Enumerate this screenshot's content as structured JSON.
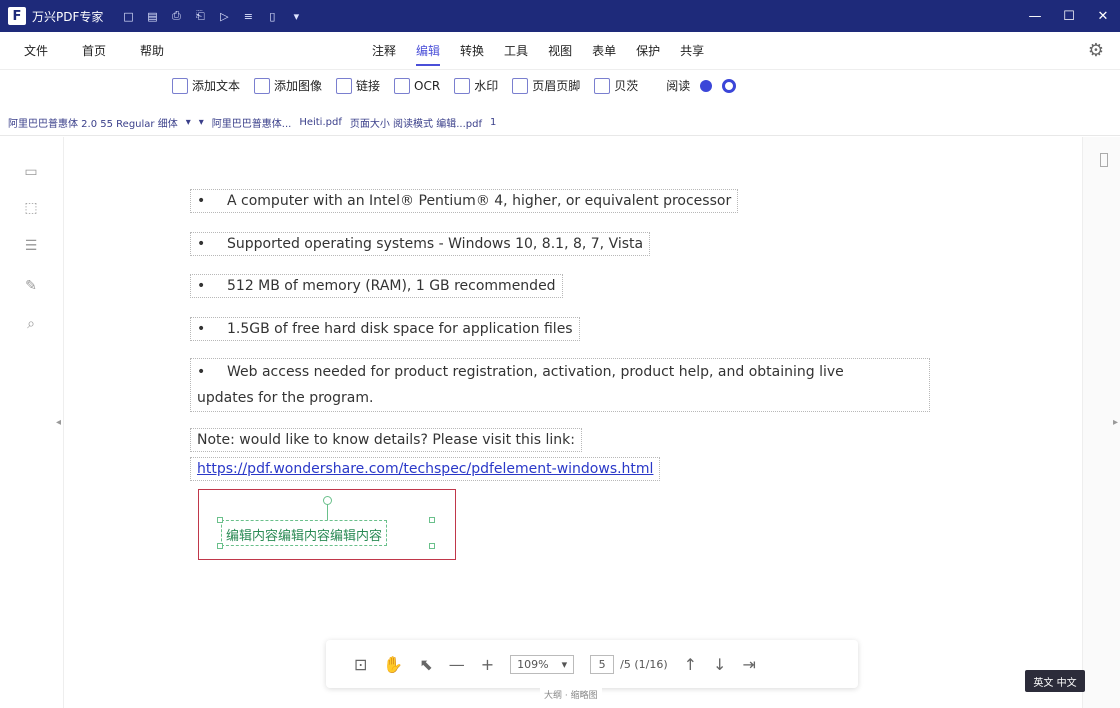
{
  "titlebar": {
    "app_name": "万兴PDF专家",
    "quick_icons": [
      "□",
      "▤",
      "⎙",
      "⎗",
      "▷",
      "≡",
      "▯",
      "▾"
    ],
    "window_controls": [
      "—",
      "☐",
      "✕"
    ]
  },
  "menubar": {
    "left_items": [
      "文件",
      "首页",
      "帮助"
    ],
    "tabs": [
      "注释",
      "编辑",
      "转换",
      "工具",
      "视图",
      "表单",
      "保护",
      "共享"
    ],
    "active_tab": "编辑",
    "right_icon": "⚙"
  },
  "ribbon": {
    "items": [
      "添加文本",
      "添加图像",
      "链接",
      "OCR",
      "水印",
      "页眉页脚",
      "贝茨"
    ],
    "extra": [
      "阅读"
    ]
  },
  "formatbar": {
    "segments": [
      "阿里巴巴普惠体 2.0 55 Regular 细体",
      "▾",
      "▾",
      "阿里巴巴普惠体...",
      "Heiti.pdf",
      "页面大小 阅读模式 编辑...pdf",
      "1"
    ]
  },
  "document": {
    "bullet": "•",
    "bullets": [
      "A computer with an Intel® Pentium® 4, higher, or equivalent processor",
      "Supported operating systems - Windows 10, 8.1, 8, 7, Vista",
      "512 MB of memory (RAM), 1 GB recommended",
      "1.5GB of free hard disk space for application files",
      "Web access needed for product registration, activation, product help, and obtaining live"
    ],
    "bullet5_cont": "updates for the program.",
    "note": "Note: would like to know details? Please visit this link:",
    "link": "https://pdf.wondershare.com/techspec/pdfelement-windows.html",
    "selected_text": "编辑内容编辑内容编辑内容"
  },
  "pagebar": {
    "zoom": "109%",
    "page_input": "5",
    "page_total": "/5 (1/16)",
    "under_label": "大纲 · 缩略图"
  },
  "corner_button": "英文 中文"
}
